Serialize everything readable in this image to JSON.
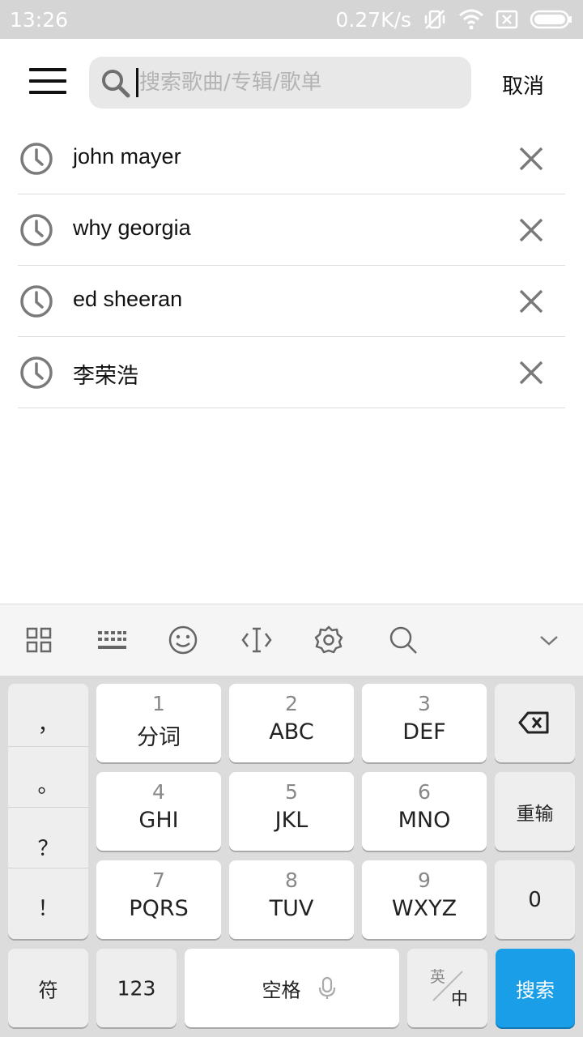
{
  "status_bar": {
    "time": "13:26",
    "speed": "0.27K/s"
  },
  "header": {
    "search_placeholder": "搜索歌曲/专辑/歌单",
    "cancel_label": "取消"
  },
  "history": [
    {
      "text": "john mayer"
    },
    {
      "text": "why georgia"
    },
    {
      "text": "ed sheeran"
    },
    {
      "text": "李荣浩"
    }
  ],
  "keyboard": {
    "punctuation": [
      "，",
      "。",
      "？",
      "！"
    ],
    "keys": [
      {
        "num": "1",
        "letters": "分词"
      },
      {
        "num": "2",
        "letters": "ABC"
      },
      {
        "num": "3",
        "letters": "DEF"
      },
      {
        "num": "4",
        "letters": "GHI"
      },
      {
        "num": "5",
        "letters": "JKL"
      },
      {
        "num": "6",
        "letters": "MNO"
      },
      {
        "num": "7",
        "letters": "PQRS"
      },
      {
        "num": "8",
        "letters": "TUV"
      },
      {
        "num": "9",
        "letters": "WXYZ"
      }
    ],
    "reinput_label": "重输",
    "zero_label": "0",
    "symbol_label": "符",
    "number_label": "123",
    "space_label": "空格",
    "lang_top": "英",
    "lang_bottom": "中",
    "search_label": "搜索",
    "accent_color": "#1a9ee8"
  }
}
